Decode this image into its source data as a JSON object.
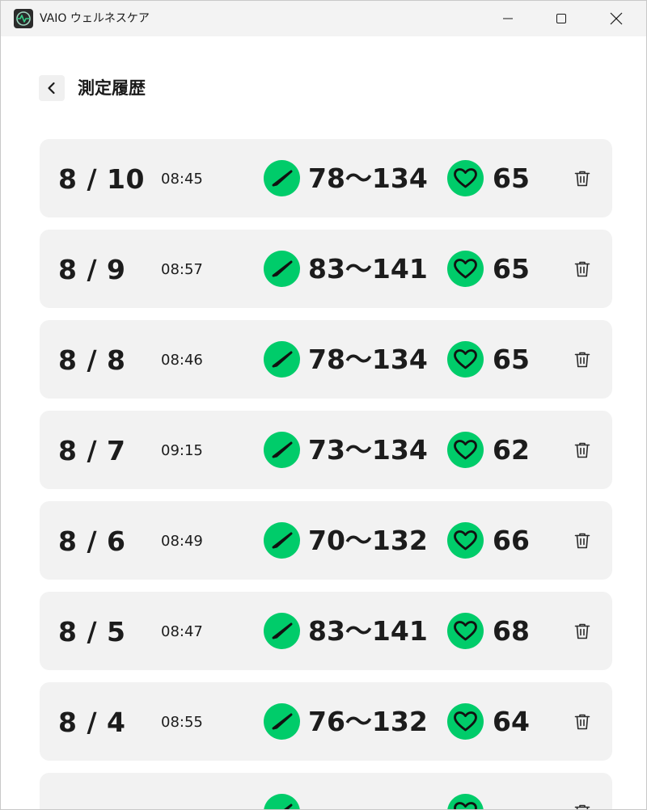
{
  "window": {
    "title": "VAIO ウェルネスケア",
    "icon": "vaio-wellness-app-icon",
    "accent": "#00cc6a"
  },
  "page": {
    "title": "測定履歴",
    "back_icon": "chevron-left-icon"
  },
  "records": [
    {
      "date": "8 / 10",
      "time": "08:45",
      "bp": "78〜134",
      "hr": "65"
    },
    {
      "date": "8 / 9",
      "time": "08:57",
      "bp": "83〜141",
      "hr": "65"
    },
    {
      "date": "8 / 8",
      "time": "08:46",
      "bp": "78〜134",
      "hr": "65"
    },
    {
      "date": "8 / 7",
      "time": "09:15",
      "bp": "73〜134",
      "hr": "62"
    },
    {
      "date": "8 / 6",
      "time": "08:49",
      "bp": "70〜132",
      "hr": "66"
    },
    {
      "date": "8 / 5",
      "time": "08:47",
      "bp": "83〜141",
      "hr": "68"
    },
    {
      "date": "8 / 4",
      "time": "08:55",
      "bp": "76〜132",
      "hr": "64"
    }
  ],
  "icons": {
    "blood_pressure": "gauge-icon",
    "heart_rate": "heart-icon",
    "delete": "trash-icon"
  }
}
